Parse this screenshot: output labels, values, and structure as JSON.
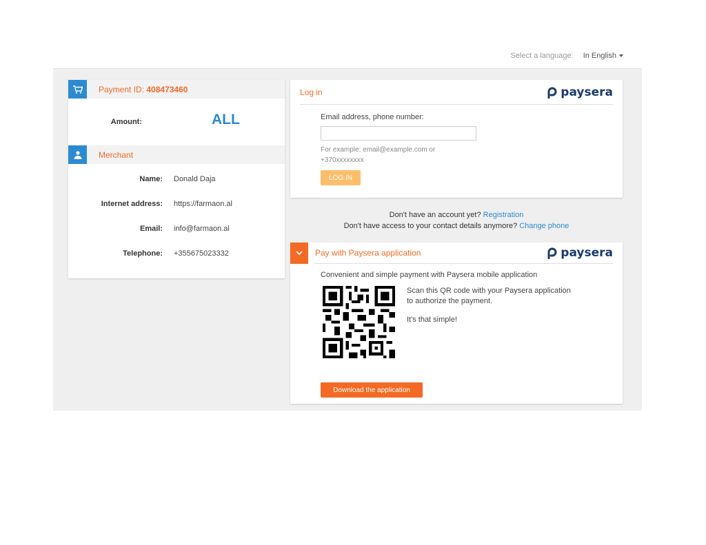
{
  "language_bar": {
    "prompt": "Select a language:",
    "selected": "In English"
  },
  "payment": {
    "label": "Payment ID:",
    "id": "408473460",
    "amount_label": "Amount:",
    "amount_value": "ALL"
  },
  "merchant": {
    "title": "Merchant",
    "rows": [
      {
        "label": "Name:",
        "value": "Donald Daja"
      },
      {
        "label": "Internet address:",
        "value": "https://farmaon.al"
      },
      {
        "label": "Email:",
        "value": "info@farmaon.al"
      },
      {
        "label": "Telephone:",
        "value": "+355675023332"
      }
    ]
  },
  "login": {
    "title": "Log in",
    "brand": "paysera",
    "field_label": "Email address, phone number:",
    "input_value": "",
    "hint": "For example: email@example.com or +370xxxxxxxx",
    "button": "LOG IN"
  },
  "links": {
    "no_account": "Don't have an account yet?",
    "registration": "Registration",
    "no_access": "Don't have access to your contact details anymore?",
    "change_phone": "Change phone"
  },
  "app": {
    "title": "Pay with Paysera application",
    "brand": "paysera",
    "description": "Convenient and simple payment with Paysera mobile application",
    "scan_text": "Scan this QR code with your Paysera application to authorize the payment.",
    "simple_text": "It's that simple!",
    "download_button": "Download the application"
  },
  "colors": {
    "accent": "#f26a24",
    "blue": "#2c8ad1",
    "brand_dark": "#1b3a6b",
    "login_button": "#fdbe6b"
  }
}
